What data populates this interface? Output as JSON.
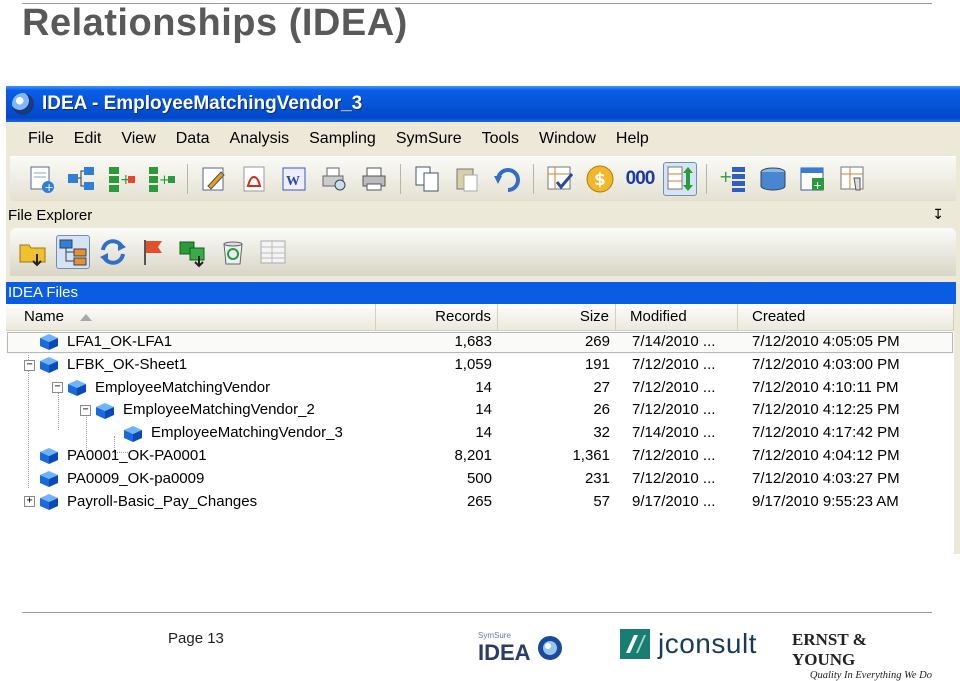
{
  "slide": {
    "title": "Relationships (IDEA)",
    "page_label": "Page 13"
  },
  "window": {
    "title": "IDEA - EmployeeMatchingVendor_3"
  },
  "menu": [
    "File",
    "Edit",
    "View",
    "Data",
    "Analysis",
    "Sampling",
    "SymSure",
    "Tools",
    "Window",
    "Help"
  ],
  "toolbar": {
    "icons": [
      "new-database-icon",
      "relate-icon",
      "join-icon",
      "append-icon",
      "edit-icon",
      "pdf-icon",
      "word-icon",
      "print-preview-icon",
      "print-icon",
      "copy-icon",
      "paste-icon",
      "undo-icon",
      "field-statistics-icon",
      "currency-icon",
      "numeric-format-icon",
      "sort-icon",
      "append-field-icon",
      "database-icon",
      "criteria-icon",
      "history-icon"
    ],
    "numeric_label": "000"
  },
  "file_explorer": {
    "title": "File Explorer",
    "pin": "↧",
    "files_title": "IDEA Files",
    "columns": {
      "name": "Name",
      "records": "Records",
      "size": "Size",
      "modified": "Modified",
      "created": "Created"
    },
    "rows": [
      {
        "name": "LFA1_OK-LFA1",
        "records": "1,683",
        "size": "269",
        "modified": "7/14/2010 ...",
        "created": "7/12/2010 4:05:05 PM",
        "toggle": ""
      },
      {
        "name": "LFBK_OK-Sheet1",
        "records": "1,059",
        "size": "191",
        "modified": "7/12/2010 ...",
        "created": "7/12/2010 4:03:00 PM",
        "toggle": "−"
      },
      {
        "name": "EmployeeMatchingVendor",
        "records": "14",
        "size": "27",
        "modified": "7/12/2010 ...",
        "created": "7/12/2010 4:10:11 PM",
        "toggle": "−"
      },
      {
        "name": "EmployeeMatchingVendor_2",
        "records": "14",
        "size": "26",
        "modified": "7/12/2010 ...",
        "created": "7/12/2010 4:12:25 PM",
        "toggle": "−"
      },
      {
        "name": "EmployeeMatchingVendor_3",
        "records": "14",
        "size": "32",
        "modified": "7/14/2010 ...",
        "created": "7/12/2010 4:17:42 PM",
        "toggle": ""
      },
      {
        "name": "PA0001_OK-PA0001",
        "records": "8,201",
        "size": "1,361",
        "modified": "7/12/2010 ...",
        "created": "7/12/2010 4:04:12 PM",
        "toggle": ""
      },
      {
        "name": "PA0009_OK-pa0009",
        "records": "500",
        "size": "231",
        "modified": "7/12/2010 ...",
        "created": "7/12/2010 4:03:27 PM",
        "toggle": ""
      },
      {
        "name": "Payroll-Basic_Pay_Changes",
        "records": "265",
        "size": "57",
        "modified": "9/17/2010 ...",
        "created": "9/17/2010 9:55:23 AM",
        "toggle": "+"
      }
    ]
  },
  "footer": {
    "idea_logo_text": "IDEA",
    "idea_logo_small": "SymSure",
    "jconsult_text": "jconsult",
    "ey_name": "ERNST & YOUNG",
    "ey_tagline": "Quality In Everything We Do"
  }
}
